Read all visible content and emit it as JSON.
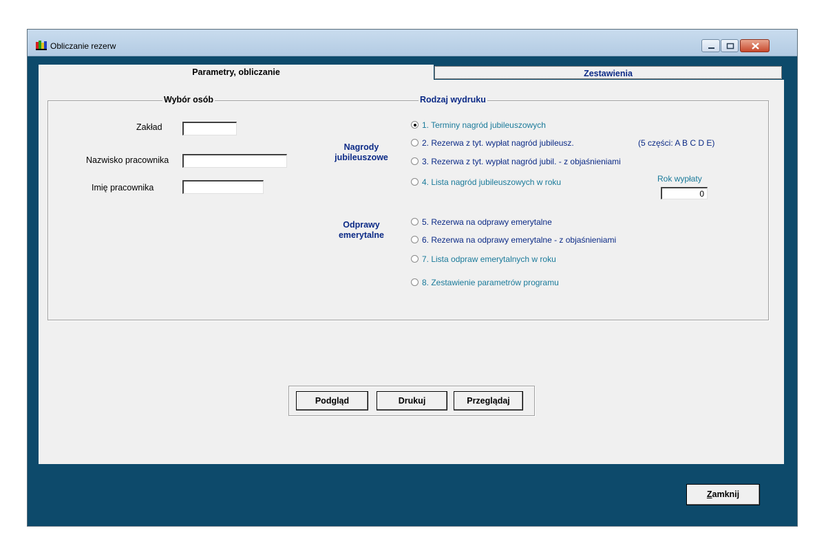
{
  "window": {
    "title": "Obliczanie rezerw"
  },
  "tabs": {
    "params": "Parametry, obliczanie",
    "summaries": "Zestawienia"
  },
  "selection": {
    "legend": "Wybór osób",
    "department_label": "Zakład",
    "department_value": "",
    "surname_label": "Nazwisko pracownika",
    "surname_value": "",
    "firstname_label": "Imię pracownika",
    "firstname_value": ""
  },
  "printout": {
    "legend": "Rodzaj wydruku",
    "group_jubilee": "Nagrody jubileuszowe",
    "group_retirement": "Odprawy emerytalne",
    "options": [
      {
        "label": "1.  Terminy nagród jubileuszowych",
        "checked": true
      },
      {
        "label": "2.  Rezerwa z tyt. wypłat nagród jubileusz.",
        "checked": false
      },
      {
        "label": "3.  Rezerwa z tyt. wypłat nagród jubil. - z objaśnieniami",
        "checked": false
      },
      {
        "label": "4.  Lista nagród jubileuszowych w roku",
        "checked": false
      },
      {
        "label": "5.  Rezerwa na odprawy emerytalne",
        "checked": false
      },
      {
        "label": "6.  Rezerwa na odprawy emerytalne - z objaśnieniami",
        "checked": false
      },
      {
        "label": "7.  Lista odpraw emerytalnych w roku",
        "checked": false
      },
      {
        "label": "8.  Zestawienie parametrów programu",
        "checked": false
      }
    ],
    "parts_note": "(5 części: A B C D E)",
    "year_label": "Rok wypłaty",
    "year_value": "0"
  },
  "buttons": {
    "preview": "Podgląd",
    "print": "Drukuj",
    "browse": "Przeglądaj",
    "close_first": "Z",
    "close_rest": "amknij"
  }
}
